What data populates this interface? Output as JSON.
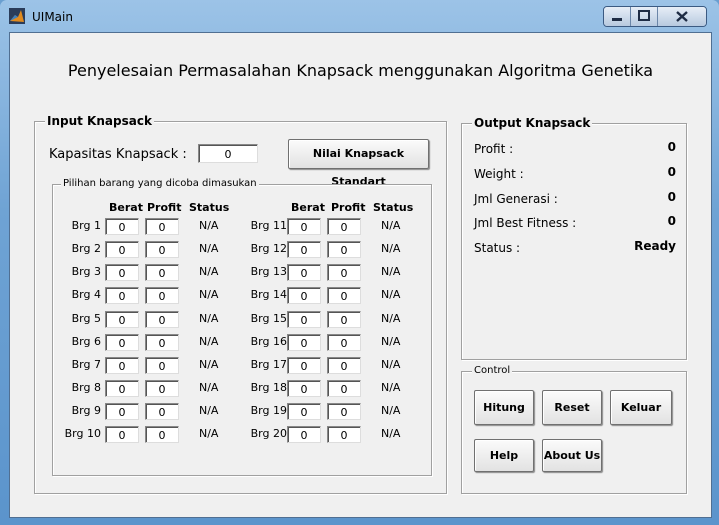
{
  "window": {
    "title": "UIMain"
  },
  "heading": "Penyelesaian Permasalahan Knapsack menggunakan Algoritma Genetika",
  "input": {
    "group_title": "Input Knapsack",
    "capacity_label": "Kapasitas Knapsack :",
    "capacity_value": "0",
    "standard_button": "Nilai Knapsack Standart",
    "items_group_title": "Pilihan barang yang dicoba dimasukan",
    "col_berat": "Berat",
    "col_profit": "Profit",
    "col_status": "Status",
    "items": [
      {
        "label": "Brg 1",
        "berat": "0",
        "profit": "0",
        "status": "N/A"
      },
      {
        "label": "Brg 2",
        "berat": "0",
        "profit": "0",
        "status": "N/A"
      },
      {
        "label": "Brg 3",
        "berat": "0",
        "profit": "0",
        "status": "N/A"
      },
      {
        "label": "Brg 4",
        "berat": "0",
        "profit": "0",
        "status": "N/A"
      },
      {
        "label": "Brg 5",
        "berat": "0",
        "profit": "0",
        "status": "N/A"
      },
      {
        "label": "Brg 6",
        "berat": "0",
        "profit": "0",
        "status": "N/A"
      },
      {
        "label": "Brg 7",
        "berat": "0",
        "profit": "0",
        "status": "N/A"
      },
      {
        "label": "Brg 8",
        "berat": "0",
        "profit": "0",
        "status": "N/A"
      },
      {
        "label": "Brg 9",
        "berat": "0",
        "profit": "0",
        "status": "N/A"
      },
      {
        "label": "Brg 10",
        "berat": "0",
        "profit": "0",
        "status": "N/A"
      },
      {
        "label": "Brg 11",
        "berat": "0",
        "profit": "0",
        "status": "N/A"
      },
      {
        "label": "Brg 12",
        "berat": "0",
        "profit": "0",
        "status": "N/A"
      },
      {
        "label": "Brg 13",
        "berat": "0",
        "profit": "0",
        "status": "N/A"
      },
      {
        "label": "Brg 14",
        "berat": "0",
        "profit": "0",
        "status": "N/A"
      },
      {
        "label": "Brg 15",
        "berat": "0",
        "profit": "0",
        "status": "N/A"
      },
      {
        "label": "Brg 16",
        "berat": "0",
        "profit": "0",
        "status": "N/A"
      },
      {
        "label": "Brg 17",
        "berat": "0",
        "profit": "0",
        "status": "N/A"
      },
      {
        "label": "Brg 18",
        "berat": "0",
        "profit": "0",
        "status": "N/A"
      },
      {
        "label": "Brg 19",
        "berat": "0",
        "profit": "0",
        "status": "N/A"
      },
      {
        "label": "Brg 20",
        "berat": "0",
        "profit": "0",
        "status": "N/A"
      }
    ]
  },
  "output": {
    "group_title": "Output Knapsack",
    "rows": [
      {
        "label": "Profit :",
        "value": "0"
      },
      {
        "label": "Weight :",
        "value": "0"
      },
      {
        "label": "Jml Generasi :",
        "value": "0"
      },
      {
        "label": "Jml Best Fitness :",
        "value": "0"
      },
      {
        "label": "Status :",
        "value": "Ready"
      }
    ]
  },
  "control": {
    "group_title": "Control",
    "hitung": "Hitung",
    "reset": "Reset",
    "keluar": "Keluar",
    "help": "Help",
    "about": "About Us"
  }
}
